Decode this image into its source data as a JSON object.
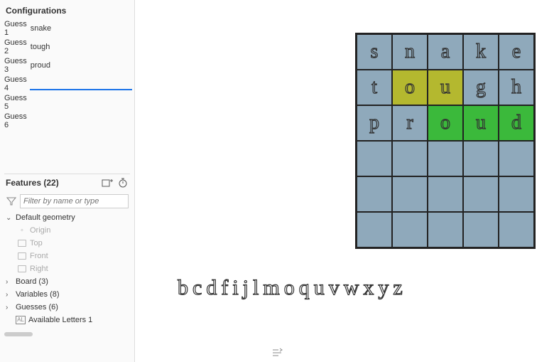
{
  "sidebar": {
    "config_title": "Configurations",
    "guesses": [
      {
        "label": "Guess 1",
        "value": "snake",
        "active": false
      },
      {
        "label": "Guess 2",
        "value": "tough",
        "active": false
      },
      {
        "label": "Guess 3",
        "value": "proud",
        "active": false
      },
      {
        "label": "Guess 4",
        "value": "",
        "active": true
      },
      {
        "label": "Guess 5",
        "value": "",
        "active": false
      },
      {
        "label": "Guess 6",
        "value": "",
        "active": false
      }
    ],
    "features_title": "Features (22)",
    "filter_placeholder": "Filter by name or type",
    "tree": {
      "default_geometry": "Default geometry",
      "origin": "Origin",
      "top": "Top",
      "front": "Front",
      "right": "Right",
      "board": "Board (3)",
      "variables": "Variables (8)",
      "guesses": "Guesses (6)",
      "available_letters": "Available Letters 1"
    }
  },
  "board": {
    "rows": [
      [
        {
          "l": "s",
          "c": "none"
        },
        {
          "l": "n",
          "c": "none"
        },
        {
          "l": "a",
          "c": "none"
        },
        {
          "l": "k",
          "c": "none"
        },
        {
          "l": "e",
          "c": "none"
        }
      ],
      [
        {
          "l": "t",
          "c": "none"
        },
        {
          "l": "o",
          "c": "yellow"
        },
        {
          "l": "u",
          "c": "yellow"
        },
        {
          "l": "g",
          "c": "none"
        },
        {
          "l": "h",
          "c": "none"
        }
      ],
      [
        {
          "l": "p",
          "c": "none"
        },
        {
          "l": "r",
          "c": "none"
        },
        {
          "l": "o",
          "c": "green"
        },
        {
          "l": "u",
          "c": "green"
        },
        {
          "l": "d",
          "c": "green"
        }
      ],
      [
        {
          "l": "",
          "c": "empty"
        },
        {
          "l": "",
          "c": "empty"
        },
        {
          "l": "",
          "c": "empty"
        },
        {
          "l": "",
          "c": "empty"
        },
        {
          "l": "",
          "c": "empty"
        }
      ],
      [
        {
          "l": "",
          "c": "empty"
        },
        {
          "l": "",
          "c": "empty"
        },
        {
          "l": "",
          "c": "empty"
        },
        {
          "l": "",
          "c": "empty"
        },
        {
          "l": "",
          "c": "empty"
        }
      ],
      [
        {
          "l": "",
          "c": "empty"
        },
        {
          "l": "",
          "c": "empty"
        },
        {
          "l": "",
          "c": "empty"
        },
        {
          "l": "",
          "c": "empty"
        },
        {
          "l": "",
          "c": "empty"
        }
      ]
    ]
  },
  "available_letters": [
    "b",
    "c",
    "d",
    "f",
    "i",
    "j",
    "l",
    "m",
    "o",
    "q",
    "u",
    "v",
    "w",
    "x",
    "y",
    "z"
  ]
}
